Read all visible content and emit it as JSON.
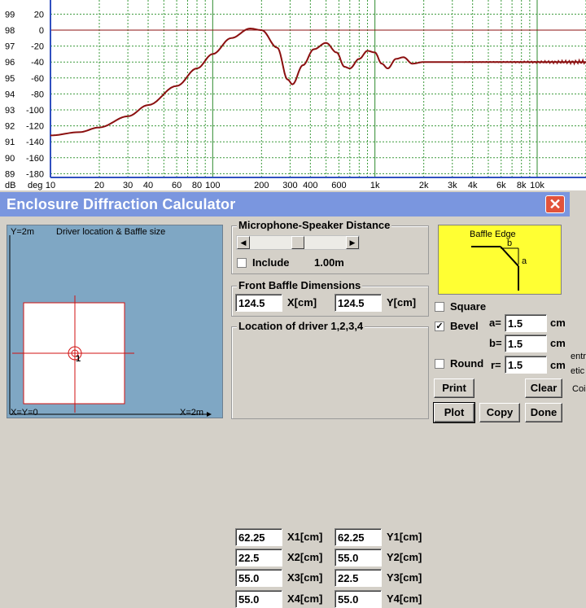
{
  "chart_data": {
    "type": "line",
    "x_scale": "log",
    "xlim": [
      10,
      20000
    ],
    "y_left_label": "dB",
    "y_right_label": "deg",
    "y_left_ticks": [
      "99",
      "98",
      "97",
      "96",
      "95",
      "94",
      "93",
      "92",
      "91",
      "90",
      "89"
    ],
    "y_right_ticks": [
      "20",
      "0",
      "-20",
      "-40",
      "-60",
      "-80",
      "-100",
      "-120",
      "-140",
      "-160",
      "-180"
    ],
    "x_tick_labels": [
      {
        "v": 10,
        "t": "10"
      },
      {
        "v": 20,
        "t": "20"
      },
      {
        "v": 30,
        "t": "30"
      },
      {
        "v": 40,
        "t": "40"
      },
      {
        "v": 60,
        "t": "60"
      },
      {
        "v": 80,
        "t": "80"
      },
      {
        "v": 100,
        "t": "100"
      },
      {
        "v": 200,
        "t": "200"
      },
      {
        "v": 300,
        "t": "300"
      },
      {
        "v": 400,
        "t": "400"
      },
      {
        "v": 600,
        "t": "600"
      },
      {
        "v": 1000,
        "t": "1k"
      },
      {
        "v": 2000,
        "t": "2k"
      },
      {
        "v": 3000,
        "t": "3k"
      },
      {
        "v": 4000,
        "t": "4k"
      },
      {
        "v": 6000,
        "t": "6k"
      },
      {
        "v": 8000,
        "t": "8k"
      },
      {
        "v": 10000,
        "t": "10k"
      }
    ],
    "reference_level_db": 98,
    "series": [
      {
        "color": "#8b1010",
        "points": [
          [
            10,
            91.4
          ],
          [
            15,
            91.6
          ],
          [
            20,
            91.9
          ],
          [
            30,
            92.6
          ],
          [
            40,
            93.3
          ],
          [
            60,
            94.5
          ],
          [
            80,
            95.6
          ],
          [
            100,
            96.5
          ],
          [
            130,
            97.5
          ],
          [
            170,
            98.1
          ],
          [
            200,
            98.0
          ],
          [
            250,
            96.9
          ],
          [
            290,
            94.9
          ],
          [
            310,
            94.6
          ],
          [
            360,
            95.8
          ],
          [
            420,
            96.8
          ],
          [
            500,
            97.2
          ],
          [
            580,
            96.6
          ],
          [
            650,
            95.7
          ],
          [
            700,
            95.6
          ],
          [
            800,
            96.2
          ],
          [
            900,
            96.7
          ],
          [
            1000,
            96.6
          ],
          [
            1100,
            95.9
          ],
          [
            1200,
            95.6
          ],
          [
            1350,
            96.2
          ],
          [
            1500,
            96.3
          ],
          [
            1700,
            95.9
          ],
          [
            2000,
            96.0
          ],
          [
            3000,
            96.0
          ],
          [
            10000,
            96.0
          ],
          [
            20000,
            96.0
          ]
        ]
      }
    ]
  },
  "window": {
    "title": "Enclosure Diffraction Calculator",
    "close_glyph": "✕"
  },
  "baffle_view": {
    "y_label": "Y=2m",
    "caption": "Driver location & Baffle size",
    "origin_label": "X=Y=0",
    "x_label": "X=2m",
    "driver_number": "1"
  },
  "mic": {
    "title": "Microphone-Speaker Distance",
    "include_label": "Include",
    "include_checked": false,
    "distance": "1.00m",
    "slider_level": 0.5
  },
  "front_baffle": {
    "title": "Front Baffle Dimensions",
    "x_value": "124.5",
    "x_unit": "X[cm]",
    "y_value": "124.5",
    "y_unit": "Y[cm]"
  },
  "drivers": {
    "title": "Location of driver 1,2,3,4",
    "rows": [
      {
        "x": "62.25",
        "xl": "X1[cm]",
        "y": "62.25",
        "yl": "Y1[cm]"
      },
      {
        "x": "22.5",
        "xl": "X2[cm]",
        "y": "55.0",
        "yl": "Y2[cm]"
      },
      {
        "x": "55.0",
        "xl": "X3[cm]",
        "y": "22.5",
        "yl": "Y3[cm]"
      },
      {
        "x": "55.0",
        "xl": "X4[cm]",
        "y": "55.0",
        "yl": "Y4[cm]"
      }
    ]
  },
  "edge": {
    "title": "Baffle Edge",
    "b_label": "b",
    "a_label": "a",
    "square_label": "Square",
    "square_checked": false,
    "bevel_label": "Bevel",
    "bevel_checked": true,
    "round_label": "Round",
    "round_checked": false,
    "a_prefix": "a=",
    "a_value": "1.5",
    "b_prefix": "b=",
    "b_value": "1.5",
    "r_prefix": "r=",
    "r_value": "1.5",
    "unit": "cm"
  },
  "buttons": {
    "print": "Print",
    "clear": "Clear",
    "plot": "Plot",
    "copy": "Copy",
    "done": "Done"
  },
  "behind_window": {
    "line1": "entr",
    "line2": "etic",
    "line3": "Coi"
  }
}
